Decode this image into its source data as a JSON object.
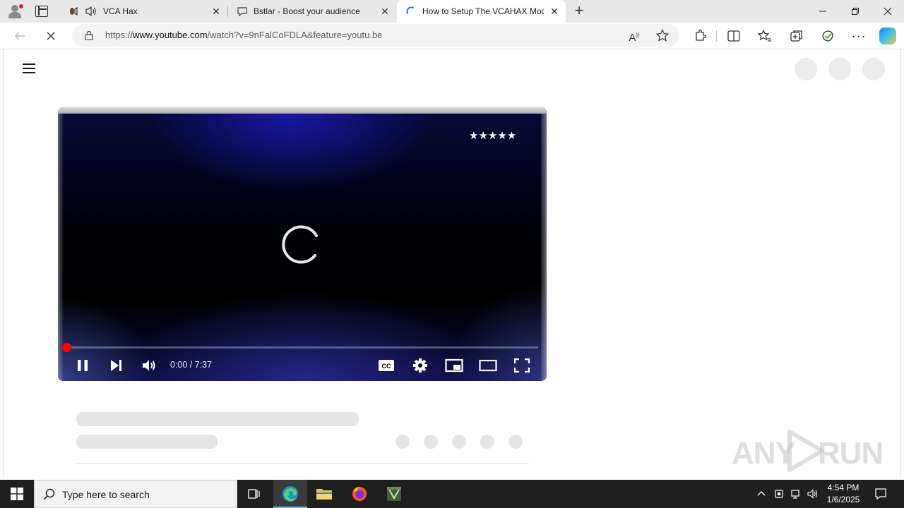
{
  "browser": {
    "tabs": [
      {
        "title": "VCA Hax",
        "favicon": "vca-favicon",
        "active": false
      },
      {
        "title": "Bstlar - Boost your audience",
        "favicon": "chat-bubble-icon",
        "active": false
      },
      {
        "title": "How to Setup The VCAHAX Mod",
        "favicon": "loading-spinner-icon",
        "active": true
      }
    ],
    "address": {
      "scheme": "https://",
      "domain": "www.youtube.com",
      "path": "/watch?v=9nFalCoFDLA&feature=youtu.be"
    }
  },
  "video": {
    "rating_text": "★★★★★",
    "time_display": "0:00 / 7:37",
    "progress_fraction": 0.0,
    "accent_color": "#ff0000"
  },
  "watermark": {
    "left": "ANY",
    "right": "RUN"
  },
  "taskbar": {
    "search_placeholder": "Type here to search",
    "clock_time": "4:54 PM",
    "clock_date": "1/6/2025"
  }
}
